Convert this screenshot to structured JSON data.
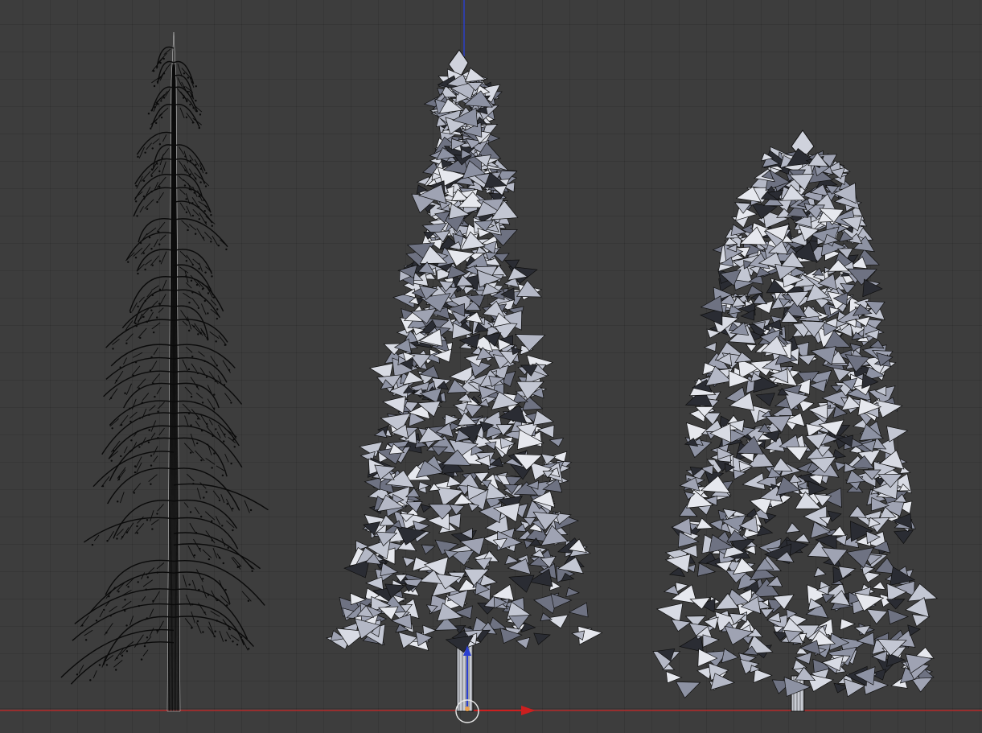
{
  "viewport": {
    "background": "#3d3d3d",
    "grid": true,
    "x_axis_color": "#b52a2a",
    "z_axis_color": "#2a3fd0",
    "y_axis_arrow_color": "#2a3fd0",
    "x_axis_arrow_color": "#cc1f1f"
  },
  "objects": [
    {
      "name": "tree-trunk-and-branches",
      "style": "wireframe",
      "fill": null,
      "stroke": "#0a0a0a"
    },
    {
      "name": "spruce-tree",
      "style": "solid-wireframe",
      "fill": "#b8bcc8",
      "stroke": "#0f0f0f"
    },
    {
      "name": "fir-tree",
      "style": "solid-wireframe",
      "fill": "#aeb2c0",
      "stroke": "#0f0f0f"
    }
  ],
  "widgets": {
    "origin_marker": "3d-cursor",
    "manipulator": "translate-gizmo"
  }
}
